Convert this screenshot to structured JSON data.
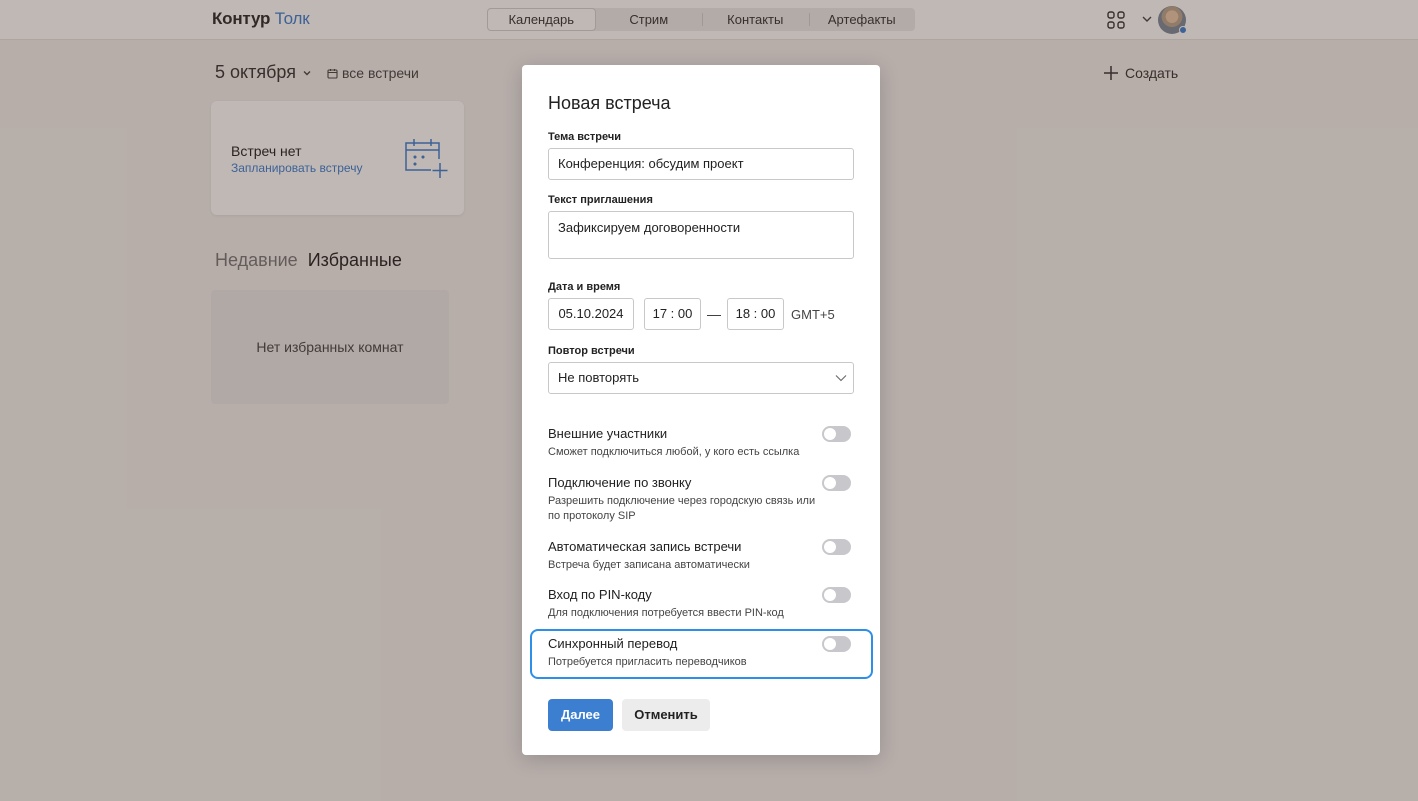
{
  "header": {
    "logo_part1": "Контур",
    "logo_part2": "Толк",
    "tabs": [
      {
        "label": "Календарь",
        "active": true
      },
      {
        "label": "Стрим",
        "active": false
      },
      {
        "label": "Контакты",
        "active": false
      },
      {
        "label": "Артефакты",
        "active": false
      }
    ],
    "icons": [
      "grid-apps-icon",
      "chevron-down-icon",
      "avatar"
    ],
    "accent": "#3c7fd1"
  },
  "main": {
    "date_label": "5 октября",
    "all_meetings": "все встречи",
    "create_label": "Создать",
    "no_meetings_title": "Встреч нет",
    "schedule_link": "Запланировать встречу",
    "tab_recent": "Недавние",
    "tab_favorites": "Избранные",
    "no_favorites": "Нет избранных комнат"
  },
  "modal": {
    "title": "Новая встреча",
    "topic": {
      "label": "Тема встречи",
      "value": "Конференция: обсудим проект"
    },
    "invite": {
      "label": "Текст приглашения",
      "value": "Зафиксируем договоренности"
    },
    "datetime": {
      "label": "Дата и время",
      "date": "05.10.2024",
      "start": "17 : 00",
      "dash": "—",
      "end": "18 : 00",
      "tz": "GMT+5"
    },
    "repeat": {
      "label": "Повтор встречи",
      "value": "Не повторять"
    },
    "options": [
      {
        "title": "Внешние участники",
        "subtitle": "Сможет подключиться любой, у кого есть ссылка",
        "enabled": false
      },
      {
        "title": "Подключение по звонку",
        "subtitle": "Разрешить подключение через городскую связь или по протоколу SIP",
        "enabled": false
      },
      {
        "title": "Автоматическая запись встречи",
        "subtitle": "Встреча будет записана автоматически",
        "enabled": false
      },
      {
        "title": "Вход по PIN-коду",
        "subtitle": "Для подключения потребуется ввести PIN-код",
        "enabled": false
      },
      {
        "title": "Синхронный перевод",
        "subtitle": "Потребуется пригласить переводчиков",
        "enabled": false
      }
    ],
    "next_label": "Далее",
    "cancel_label": "Отменить",
    "highlight_color": "#2d8fe8"
  }
}
